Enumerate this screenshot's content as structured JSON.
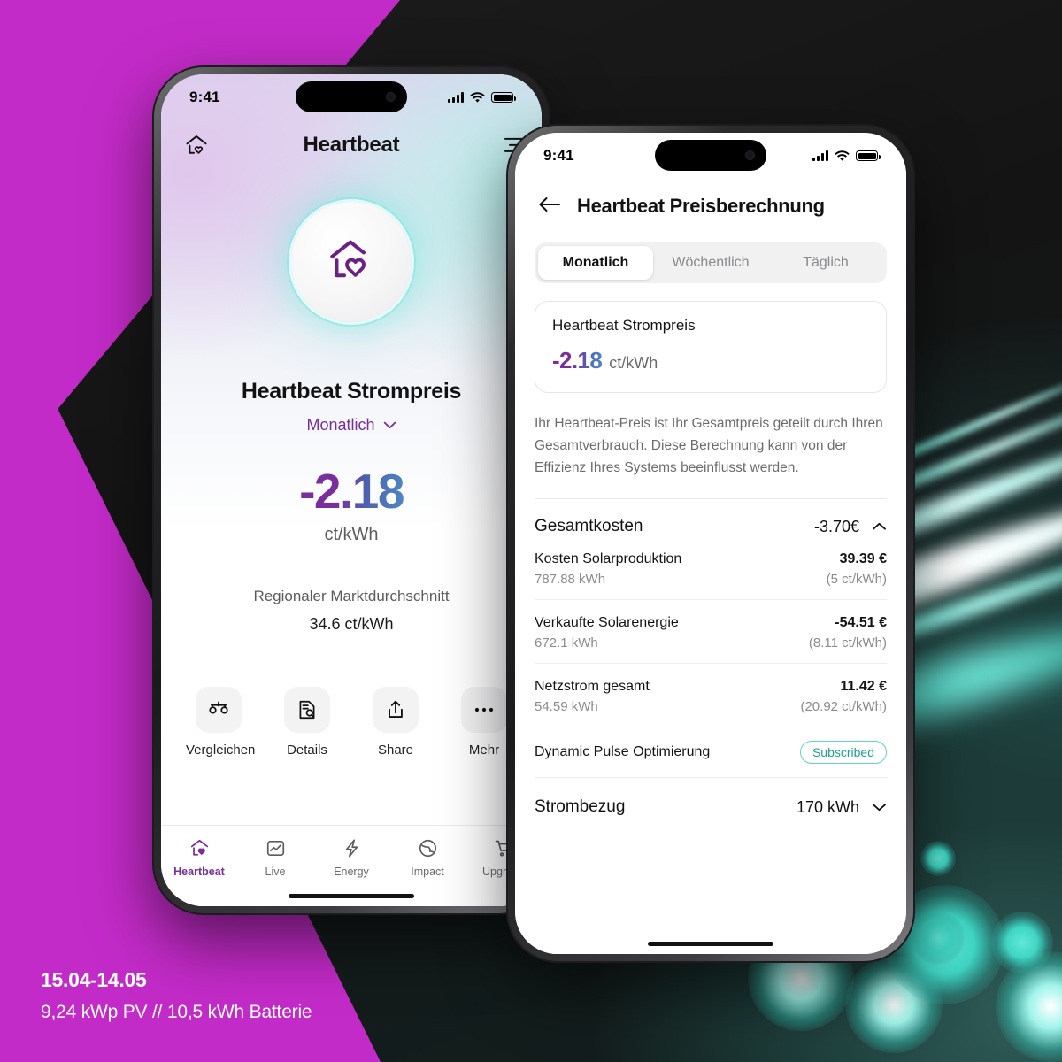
{
  "background": {
    "magenta": "#C32BC8",
    "dark": "#1a1a1a",
    "teal_accent": "#3fd6c4"
  },
  "caption": {
    "date_range": "15.04-14.05",
    "system": "9,24 kWp PV // 10,5 kWh Batterie"
  },
  "phone1": {
    "status_bar": {
      "time": "9:41",
      "signal_icon": "signal-bars-icon",
      "wifi_icon": "wifi-icon",
      "battery_icon": "battery-icon"
    },
    "topbar": {
      "home_icon": "home-heart-icon",
      "title": "Heartbeat",
      "menu_icon": "hamburger-menu-icon"
    },
    "logo_icon": "home-heart-logo-icon",
    "hero": {
      "title": "Heartbeat Strompreis",
      "period": "Monatlich",
      "period_chevron_icon": "chevron-down-icon",
      "price": "-2.18",
      "unit": "ct/kWh",
      "average_label": "Regionaler Marktdurchschnitt",
      "average_value": "34.6 ct/kWh",
      "price_gradient_from": "#7A2E9B",
      "price_gradient_to": "#4f87c4"
    },
    "actions": [
      {
        "label": "Vergleichen",
        "icon": "scales-compare-icon"
      },
      {
        "label": "Details",
        "icon": "document-search-icon"
      },
      {
        "label": "Share",
        "icon": "share-upload-icon"
      },
      {
        "label": "Mehr",
        "icon": "more-dots-icon"
      }
    ],
    "tabs": [
      {
        "label": "Heartbeat",
        "icon": "home-heart-icon",
        "active": true
      },
      {
        "label": "Live",
        "icon": "chart-image-icon",
        "active": false
      },
      {
        "label": "Energy",
        "icon": "lightning-bolt-icon",
        "active": false
      },
      {
        "label": "Impact",
        "icon": "globe-impact-icon",
        "active": false
      },
      {
        "label": "Upgrade",
        "icon": "shopping-cart-icon",
        "active": false
      }
    ],
    "active_tab_color": "#7A2E9B"
  },
  "phone2": {
    "status_bar": {
      "time": "9:41",
      "signal_icon": "signal-bars-icon",
      "wifi_icon": "wifi-icon",
      "battery_icon": "battery-icon"
    },
    "nav": {
      "back_icon": "back-arrow-icon",
      "title": "Heartbeat Preisberechnung"
    },
    "segments": [
      {
        "label": "Monatlich",
        "active": true
      },
      {
        "label": "Wöchentlich",
        "active": false
      },
      {
        "label": "Täglich",
        "active": false
      }
    ],
    "price_card": {
      "title": "Heartbeat Strompreis",
      "value": "-2.18",
      "unit": "ct/kWh"
    },
    "description": "Ihr Heartbeat-Preis ist Ihr Gesamtpreis geteilt durch Ihren Gesamtverbrauch. Diese Berechnung kann von der Effizienz Ihres Systems beeinflusst werden.",
    "total_section": {
      "title": "Gesamtkosten",
      "value": "-3.70€",
      "chevron_icon": "chevron-up-icon"
    },
    "breakdown": [
      {
        "label": "Kosten Solarproduktion",
        "amount": "39.39 €",
        "kwh": "787.88 kWh",
        "rate": "(5 ct/kWh)"
      },
      {
        "label": "Verkaufte Solarenergie",
        "amount": "-54.51 €",
        "kwh": "672.1 kWh",
        "rate": "(8.11 ct/kWh)"
      },
      {
        "label": "Netzstrom gesamt",
        "amount": "11.42 €",
        "kwh": "54.59 kWh",
        "rate": "(20.92 ct/kWh)"
      }
    ],
    "subscription_row": {
      "label": "Dynamic Pulse Optimierung",
      "badge": "Subscribed",
      "badge_color": "#1f9e90"
    },
    "consumption_section": {
      "title": "Strombezug",
      "value": "170 kWh",
      "chevron_icon": "chevron-down-icon"
    }
  }
}
